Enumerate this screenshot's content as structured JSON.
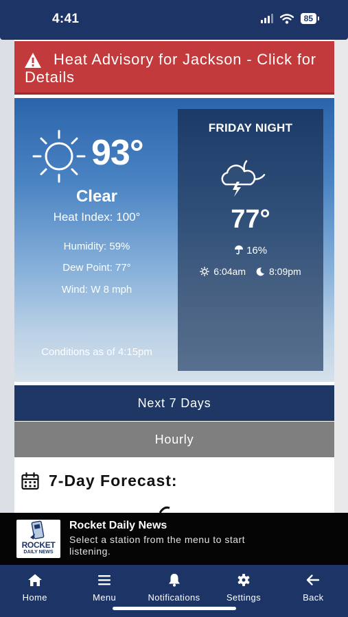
{
  "status_bar": {
    "time": "4:41",
    "battery": "85"
  },
  "alert": {
    "text": "Heat Advisory for Jackson - Click for Details"
  },
  "current": {
    "temperature": "93°",
    "condition": "Clear",
    "heat_index": "Heat Index: 100°",
    "humidity": "Humidity: 59%",
    "dew_point": "Dew Point: 77°",
    "wind": "Wind: W 8 mph",
    "as_of": "Conditions as of 4:15pm"
  },
  "tonight": {
    "label": "FRIDAY NIGHT",
    "temperature": "77°",
    "precip": "16%",
    "sunrise": "6:04am",
    "sunset": "8:09pm"
  },
  "tabs": {
    "next7": "Next 7 Days",
    "hourly": "Hourly"
  },
  "forecast": {
    "title": "7-Day Forecast:"
  },
  "player": {
    "logo_line1": "ROCKET",
    "logo_line2": "DAILY NEWS",
    "title": "Rocket Daily News",
    "subtitle": "Select a station from the menu to start listening."
  },
  "nav": [
    {
      "label": "Home",
      "icon": "home-icon"
    },
    {
      "label": "Menu",
      "icon": "menu-icon"
    },
    {
      "label": "Notifications",
      "icon": "bell-icon"
    },
    {
      "label": "Settings",
      "icon": "gear-icon"
    },
    {
      "label": "Back",
      "icon": "back-arrow-icon"
    }
  ],
  "colors": {
    "navy": "#1d3566",
    "alert_red": "#c33a3c",
    "hourly_gray": "#7f7f80"
  }
}
